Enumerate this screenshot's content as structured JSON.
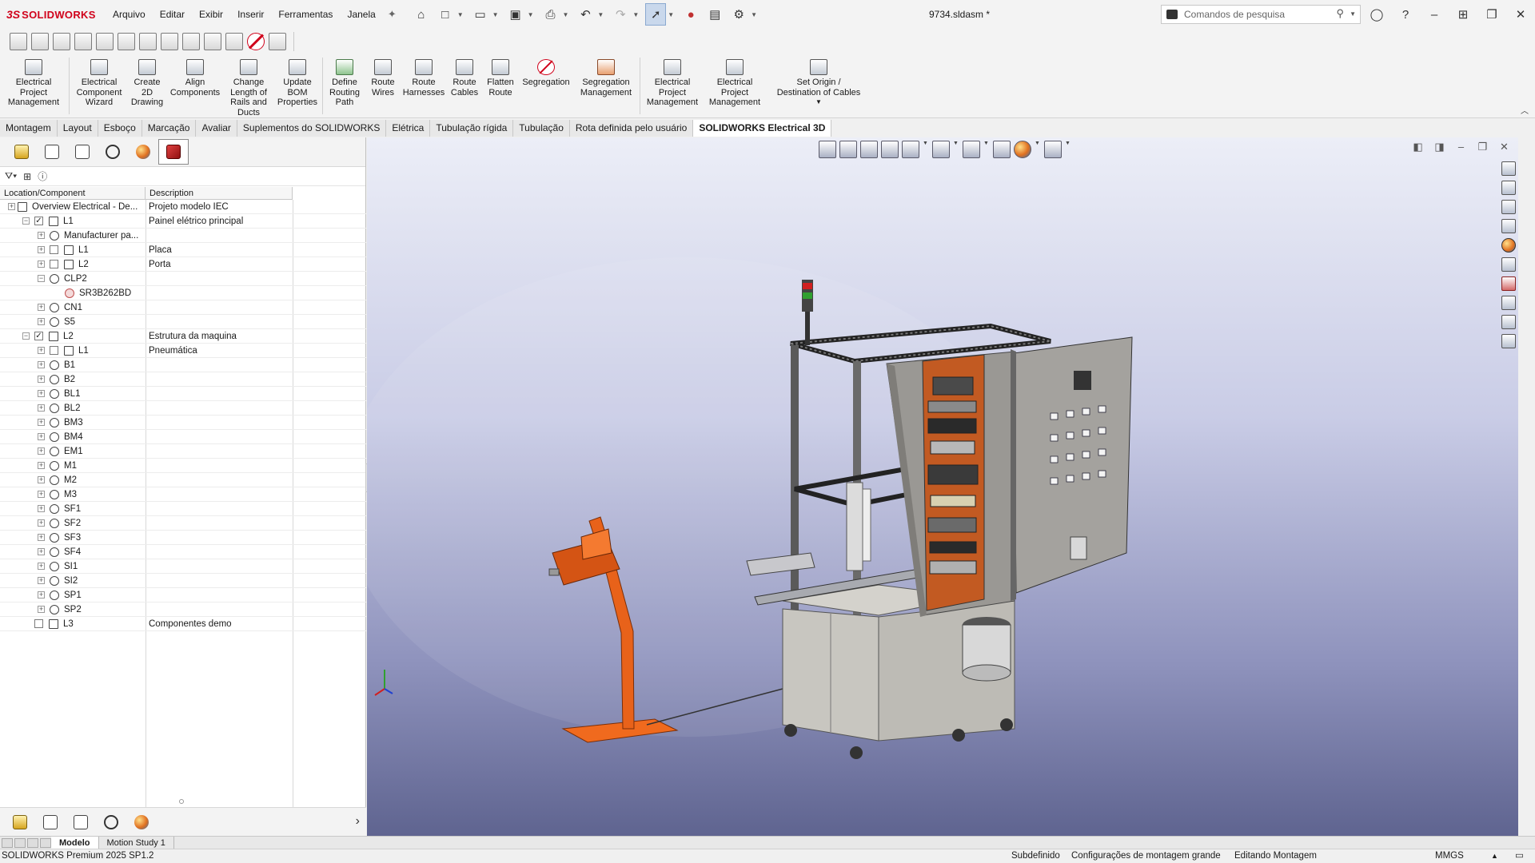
{
  "app": {
    "brand_prefix": "3S",
    "brand_name": "SOLIDWORKS",
    "document_title": "9734.sldasm *"
  },
  "menu": [
    "Arquivo",
    "Editar",
    "Exibir",
    "Inserir",
    "Ferramentas",
    "Janela"
  ],
  "search": {
    "placeholder": "Comandos de pesquisa"
  },
  "ribbon": [
    {
      "label": "Electrical\nProject\nManagement",
      "icon": "project-icon"
    },
    {
      "label": "Electrical\nComponent\nWizard",
      "icon": "wizard-icon"
    },
    {
      "label": "Create\n2D\nDrawing",
      "icon": "drawing-icon"
    },
    {
      "label": "Align\nComponents",
      "icon": "align-icon"
    },
    {
      "label": "Change\nLength of\nRails and\nDucts",
      "icon": "rail-icon"
    },
    {
      "label": "Update\nBOM\nProperties",
      "icon": "bom-icon"
    },
    {
      "label": "Define\nRouting\nPath",
      "icon": "routing-path-icon"
    },
    {
      "label": "Route\nWires",
      "icon": "route-wires-icon"
    },
    {
      "label": "Route\nHarnesses",
      "icon": "route-harness-icon"
    },
    {
      "label": "Route\nCables",
      "icon": "route-cables-icon"
    },
    {
      "label": "Flatten\nRoute",
      "icon": "flatten-icon"
    },
    {
      "label": "Segregation",
      "icon": "segregation-icon"
    },
    {
      "label": "Segregation\nManagement",
      "icon": "segregation-mgmt-icon"
    },
    {
      "label": "Electrical\nProject\nManagement",
      "icon": "project-icon"
    },
    {
      "label": "Electrical\nProject\nManagement",
      "icon": "project-icon"
    },
    {
      "label": "Set Origin /\nDestination of Cables",
      "icon": "origin-icon"
    }
  ],
  "tabs": [
    "Montagem",
    "Layout",
    "Esboço",
    "Marcação",
    "Avaliar",
    "Suplementos do SOLIDWORKS",
    "Elétrica",
    "Tubulação rígida",
    "Tubulação",
    "Rota definida pelo usuário",
    "SOLIDWORKS Electrical 3D"
  ],
  "active_tab": "SOLIDWORKS Electrical 3D",
  "tree": {
    "headers": {
      "location": "Location/Component",
      "description": "Description"
    },
    "rows": [
      {
        "label": "Overview Electrical - De...",
        "desc": "Projeto modelo IEC",
        "level": 0,
        "exp": "+",
        "chk": "",
        "icon": "project-icon"
      },
      {
        "label": "L1",
        "desc": "Painel elétrico principal",
        "level": 1,
        "exp": "-",
        "chk": "✓",
        "icon": "location-icon"
      },
      {
        "label": "Manufacturer pa...",
        "desc": "",
        "level": 2,
        "exp": "+",
        "chk": "",
        "icon": "device-icon"
      },
      {
        "label": "L1",
        "desc": "Placa",
        "level": 2,
        "exp": "+",
        "chk": " ",
        "icon": "location-icon"
      },
      {
        "label": "L2",
        "desc": "Porta",
        "level": 2,
        "exp": "+",
        "chk": " ",
        "icon": "location-icon"
      },
      {
        "label": "CLP2",
        "desc": "",
        "level": 2,
        "exp": "-",
        "chk": "",
        "icon": "device-icon"
      },
      {
        "label": "SR3B262BD",
        "desc": "",
        "level": 3,
        "exp": "",
        "chk": "",
        "icon": "part-icon"
      },
      {
        "label": "CN1",
        "desc": "",
        "level": 2,
        "exp": "+",
        "chk": "",
        "icon": "device-icon"
      },
      {
        "label": "S5",
        "desc": "",
        "level": 2,
        "exp": "+",
        "chk": "",
        "icon": "device-icon"
      },
      {
        "label": "L2",
        "desc": "Estrutura da maquina",
        "level": 1,
        "exp": "-",
        "chk": "✓",
        "icon": "location-icon"
      },
      {
        "label": "L1",
        "desc": "Pneumática",
        "level": 2,
        "exp": "+",
        "chk": " ",
        "icon": "location-icon"
      },
      {
        "label": "B1",
        "desc": "",
        "level": 2,
        "exp": "+",
        "chk": "",
        "icon": "device-icon"
      },
      {
        "label": "B2",
        "desc": "",
        "level": 2,
        "exp": "+",
        "chk": "",
        "icon": "device-icon"
      },
      {
        "label": "BL1",
        "desc": "",
        "level": 2,
        "exp": "+",
        "chk": "",
        "icon": "device-icon"
      },
      {
        "label": "BL2",
        "desc": "",
        "level": 2,
        "exp": "+",
        "chk": "",
        "icon": "device-icon"
      },
      {
        "label": "BM3",
        "desc": "",
        "level": 2,
        "exp": "+",
        "chk": "",
        "icon": "device-icon"
      },
      {
        "label": "BM4",
        "desc": "",
        "level": 2,
        "exp": "+",
        "chk": "",
        "icon": "device-icon"
      },
      {
        "label": "EM1",
        "desc": "",
        "level": 2,
        "exp": "+",
        "chk": "",
        "icon": "device-icon"
      },
      {
        "label": "M1",
        "desc": "",
        "level": 2,
        "exp": "+",
        "chk": "",
        "icon": "device-icon"
      },
      {
        "label": "M2",
        "desc": "",
        "level": 2,
        "exp": "+",
        "chk": "",
        "icon": "device-icon"
      },
      {
        "label": "M3",
        "desc": "",
        "level": 2,
        "exp": "+",
        "chk": "",
        "icon": "device-icon"
      },
      {
        "label": "SF1",
        "desc": "",
        "level": 2,
        "exp": "+",
        "chk": "",
        "icon": "device-icon"
      },
      {
        "label": "SF2",
        "desc": "",
        "level": 2,
        "exp": "+",
        "chk": "",
        "icon": "device-icon"
      },
      {
        "label": "SF3",
        "desc": "",
        "level": 2,
        "exp": "+",
        "chk": "",
        "icon": "device-icon"
      },
      {
        "label": "SF4",
        "desc": "",
        "level": 2,
        "exp": "+",
        "chk": "",
        "icon": "device-icon"
      },
      {
        "label": "SI1",
        "desc": "",
        "level": 2,
        "exp": "+",
        "chk": "",
        "icon": "device-icon"
      },
      {
        "label": "SI2",
        "desc": "",
        "level": 2,
        "exp": "+",
        "chk": "",
        "icon": "device-icon"
      },
      {
        "label": "SP1",
        "desc": "",
        "level": 2,
        "exp": "+",
        "chk": "",
        "icon": "device-icon"
      },
      {
        "label": "SP2",
        "desc": "",
        "level": 2,
        "exp": "+",
        "chk": "",
        "icon": "device-icon"
      },
      {
        "label": "L3",
        "desc": "Componentes demo",
        "level": 1,
        "exp": "",
        "chk": " ",
        "icon": "location-icon"
      }
    ]
  },
  "sheet_tabs": [
    "Modelo",
    "Motion Study 1"
  ],
  "active_sheet": "Modelo",
  "status": {
    "version": "SOLIDWORKS Premium 2025 SP1.2",
    "definition": "Subdefinido",
    "config": "Configurações de montagem grande",
    "mode": "Editando Montagem",
    "units": "MMGS"
  },
  "colors": {
    "brand": "#d0021b",
    "accent": "#c9d8ec",
    "model_orange": "#e8621a"
  }
}
